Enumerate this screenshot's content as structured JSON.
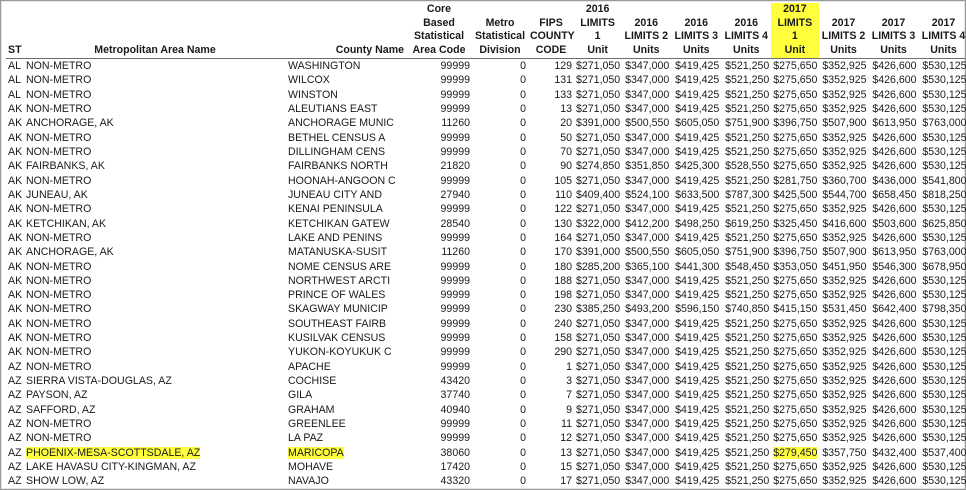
{
  "table": {
    "headers": {
      "st": "ST",
      "metro": "Metropolitan Area Name",
      "county": "County Name",
      "cbsa": "Core\nBased\nStatistical\nArea Code",
      "msd": "Metro\nStatistical\nDivision",
      "fips": "FIPS\nCOUNTY\nCODE",
      "l16_1": "2016\nLIMITS 1\nUnit",
      "l16_2": "2016\nLIMITS 2\nUnits",
      "l16_3": "2016\nLIMITS 3\nUnits",
      "l16_4": "2016\nLIMITS 4\nUnits",
      "l17_1": "2017\nLIMITS 1\nUnit",
      "l17_2": "2017\nLIMITS 2\nUnits",
      "l17_3": "2017\nLIMITS 3\nUnits",
      "l17_4": "2017\nLIMITS 4\nUnits"
    },
    "highlight_color": "#ffff3d",
    "rows": [
      [
        "AL",
        "NON-METRO",
        "WASHINGTON",
        "99999",
        "0",
        "129",
        "$271,050",
        "$347,000",
        "$419,425",
        "$521,250",
        "$275,650",
        "$352,925",
        "$426,600",
        "$530,125"
      ],
      [
        "AL",
        "NON-METRO",
        "WILCOX",
        "99999",
        "0",
        "131",
        "$271,050",
        "$347,000",
        "$419,425",
        "$521,250",
        "$275,650",
        "$352,925",
        "$426,600",
        "$530,125"
      ],
      [
        "AL",
        "NON-METRO",
        "WINSTON",
        "99999",
        "0",
        "133",
        "$271,050",
        "$347,000",
        "$419,425",
        "$521,250",
        "$275,650",
        "$352,925",
        "$426,600",
        "$530,125"
      ],
      [
        "AK",
        "NON-METRO",
        "ALEUTIANS EAST",
        "99999",
        "0",
        "13",
        "$271,050",
        "$347,000",
        "$419,425",
        "$521,250",
        "$275,650",
        "$352,925",
        "$426,600",
        "$530,125"
      ],
      [
        "AK",
        "ANCHORAGE, AK",
        "ANCHORAGE MUNIC",
        "11260",
        "0",
        "20",
        "$391,000",
        "$500,550",
        "$605,050",
        "$751,900",
        "$396,750",
        "$507,900",
        "$613,950",
        "$763,000"
      ],
      [
        "AK",
        "NON-METRO",
        "BETHEL CENSUS A",
        "99999",
        "0",
        "50",
        "$271,050",
        "$347,000",
        "$419,425",
        "$521,250",
        "$275,650",
        "$352,925",
        "$426,600",
        "$530,125"
      ],
      [
        "AK",
        "NON-METRO",
        "DILLINGHAM CENS",
        "99999",
        "0",
        "70",
        "$271,050",
        "$347,000",
        "$419,425",
        "$521,250",
        "$275,650",
        "$352,925",
        "$426,600",
        "$530,125"
      ],
      [
        "AK",
        "FAIRBANKS, AK",
        "FAIRBANKS NORTH",
        "21820",
        "0",
        "90",
        "$274,850",
        "$351,850",
        "$425,300",
        "$528,550",
        "$275,650",
        "$352,925",
        "$426,600",
        "$530,125"
      ],
      [
        "AK",
        "NON-METRO",
        "HOONAH-ANGOON C",
        "99999",
        "0",
        "105",
        "$271,050",
        "$347,000",
        "$419,425",
        "$521,250",
        "$281,750",
        "$360,700",
        "$436,000",
        "$541,800"
      ],
      [
        "AK",
        "JUNEAU, AK",
        "JUNEAU CITY AND",
        "27940",
        "0",
        "110",
        "$409,400",
        "$524,100",
        "$633,500",
        "$787,300",
        "$425,500",
        "$544,700",
        "$658,450",
        "$818,250"
      ],
      [
        "AK",
        "NON-METRO",
        "KENAI PENINSULA",
        "99999",
        "0",
        "122",
        "$271,050",
        "$347,000",
        "$419,425",
        "$521,250",
        "$275,650",
        "$352,925",
        "$426,600",
        "$530,125"
      ],
      [
        "AK",
        "KETCHIKAN, AK",
        "KETCHIKAN GATEW",
        "28540",
        "0",
        "130",
        "$322,000",
        "$412,200",
        "$498,250",
        "$619,250",
        "$325,450",
        "$416,600",
        "$503,600",
        "$625,850"
      ],
      [
        "AK",
        "NON-METRO",
        "LAKE AND PENINS",
        "99999",
        "0",
        "164",
        "$271,050",
        "$347,000",
        "$419,425",
        "$521,250",
        "$275,650",
        "$352,925",
        "$426,600",
        "$530,125"
      ],
      [
        "AK",
        "ANCHORAGE, AK",
        "MATANUSKA-SUSIT",
        "11260",
        "0",
        "170",
        "$391,000",
        "$500,550",
        "$605,050",
        "$751,900",
        "$396,750",
        "$507,900",
        "$613,950",
        "$763,000"
      ],
      [
        "AK",
        "NON-METRO",
        "NOME CENSUS ARE",
        "99999",
        "0",
        "180",
        "$285,200",
        "$365,100",
        "$441,300",
        "$548,450",
        "$353,050",
        "$451,950",
        "$546,300",
        "$678,950"
      ],
      [
        "AK",
        "NON-METRO",
        "NORTHWEST ARCTI",
        "99999",
        "0",
        "188",
        "$271,050",
        "$347,000",
        "$419,425",
        "$521,250",
        "$275,650",
        "$352,925",
        "$426,600",
        "$530,125"
      ],
      [
        "AK",
        "NON-METRO",
        "PRINCE OF WALES",
        "99999",
        "0",
        "198",
        "$271,050",
        "$347,000",
        "$419,425",
        "$521,250",
        "$275,650",
        "$352,925",
        "$426,600",
        "$530,125"
      ],
      [
        "AK",
        "NON-METRO",
        "SKAGWAY MUNICIP",
        "99999",
        "0",
        "230",
        "$385,250",
        "$493,200",
        "$596,150",
        "$740,850",
        "$415,150",
        "$531,450",
        "$642,400",
        "$798,350"
      ],
      [
        "AK",
        "NON-METRO",
        "SOUTHEAST FAIRB",
        "99999",
        "0",
        "240",
        "$271,050",
        "$347,000",
        "$419,425",
        "$521,250",
        "$275,650",
        "$352,925",
        "$426,600",
        "$530,125"
      ],
      [
        "AK",
        "NON-METRO",
        "KUSILVAK CENSUS",
        "99999",
        "0",
        "158",
        "$271,050",
        "$347,000",
        "$419,425",
        "$521,250",
        "$275,650",
        "$352,925",
        "$426,600",
        "$530,125"
      ],
      [
        "AK",
        "NON-METRO",
        "YUKON-KOYUKUK C",
        "99999",
        "0",
        "290",
        "$271,050",
        "$347,000",
        "$419,425",
        "$521,250",
        "$275,650",
        "$352,925",
        "$426,600",
        "$530,125"
      ],
      [
        "AZ",
        "NON-METRO",
        "APACHE",
        "99999",
        "0",
        "1",
        "$271,050",
        "$347,000",
        "$419,425",
        "$521,250",
        "$275,650",
        "$352,925",
        "$426,600",
        "$530,125"
      ],
      [
        "AZ",
        "SIERRA VISTA-DOUGLAS, AZ",
        "COCHISE",
        "43420",
        "0",
        "3",
        "$271,050",
        "$347,000",
        "$419,425",
        "$521,250",
        "$275,650",
        "$352,925",
        "$426,600",
        "$530,125"
      ],
      [
        "AZ",
        "PAYSON, AZ",
        "GILA",
        "37740",
        "0",
        "7",
        "$271,050",
        "$347,000",
        "$419,425",
        "$521,250",
        "$275,650",
        "$352,925",
        "$426,600",
        "$530,125"
      ],
      [
        "AZ",
        "SAFFORD, AZ",
        "GRAHAM",
        "40940",
        "0",
        "9",
        "$271,050",
        "$347,000",
        "$419,425",
        "$521,250",
        "$275,650",
        "$352,925",
        "$426,600",
        "$530,125"
      ],
      [
        "AZ",
        "NON-METRO",
        "GREENLEE",
        "99999",
        "0",
        "11",
        "$271,050",
        "$347,000",
        "$419,425",
        "$521,250",
        "$275,650",
        "$352,925",
        "$426,600",
        "$530,125"
      ],
      [
        "AZ",
        "NON-METRO",
        "LA PAZ",
        "99999",
        "0",
        "12",
        "$271,050",
        "$347,000",
        "$419,425",
        "$521,250",
        "$275,650",
        "$352,925",
        "$426,600",
        "$530,125"
      ],
      [
        "AZ",
        "PHOENIX-MESA-SCOTTSDALE, AZ",
        "MARICOPA",
        "38060",
        "0",
        "13",
        "$271,050",
        "$347,000",
        "$419,425",
        "$521,250",
        "$279,450",
        "$357,750",
        "$432,400",
        "$537,400"
      ],
      [
        "AZ",
        "LAKE HAVASU CITY-KINGMAN, AZ",
        "MOHAVE",
        "17420",
        "0",
        "15",
        "$271,050",
        "$347,000",
        "$419,425",
        "$521,250",
        "$275,650",
        "$352,925",
        "$426,600",
        "$530,125"
      ],
      [
        "AZ",
        "SHOW LOW, AZ",
        "NAVAJO",
        "43320",
        "0",
        "17",
        "$271,050",
        "$347,000",
        "$419,425",
        "$521,250",
        "$275,650",
        "$352,925",
        "$426,600",
        "$530,125"
      ]
    ],
    "highlighted_row_index": 27,
    "highlighted_columns": [
      1,
      2,
      10
    ]
  }
}
